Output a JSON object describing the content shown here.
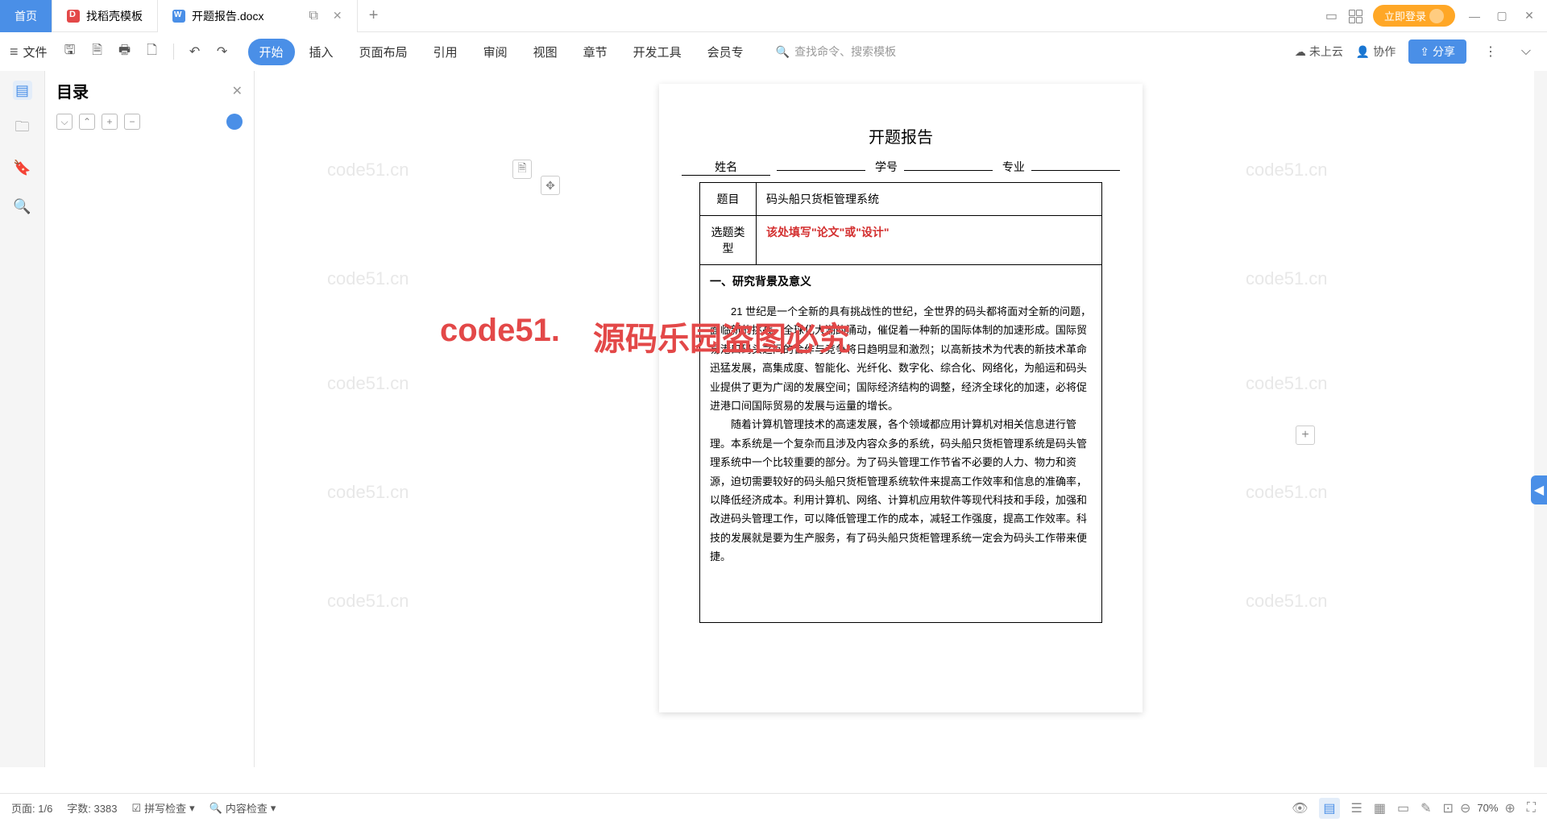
{
  "tabs": {
    "home": "首页",
    "template": "找稻壳模板",
    "doc": "开题报告.docx",
    "newtab": "+"
  },
  "titlebar": {
    "login": "立即登录"
  },
  "toolbar": {
    "file": "文件",
    "search_placeholder": "查找命令、搜索模板",
    "cloud": "未上云",
    "coop": "协作",
    "share": "分享"
  },
  "menu": {
    "start": "开始",
    "insert": "插入",
    "layout": "页面布局",
    "ref": "引用",
    "review": "审阅",
    "view": "视图",
    "chapter": "章节",
    "dev": "开发工具",
    "member": "会员专"
  },
  "sidebar": {
    "title": "目录"
  },
  "doc": {
    "title": "开题报告",
    "f1": "姓名",
    "f2": "学号",
    "f3": "专业",
    "row1_lbl": "题目",
    "row1_val": "码头船只货柜管理系统",
    "row2_lbl": "选题类型",
    "row2_val": "该处填写\"论文\"或\"设计\"",
    "h1": "一、研究背景及意义",
    "p1": "21 世纪是一个全新的具有挑战性的世纪，全世界的码头都将面对全新的问题，面临新的挑战。全球化大潮的涌动，催促着一种新的国际体制的加速形成。国际贸易港口码头之间的合作与竞争将日趋明显和激烈；以高新技术为代表的新技术革命迅猛发展，高集成度、智能化、光纤化、数字化、综合化、网络化，为船运和码头业提供了更为广阔的发展空间；国际经济结构的调整，经济全球化的加速，必将促进港口间国际贸易的发展与运量的增长。",
    "p2": "随着计算机管理技术的高速发展，各个领域都应用计算机对相关信息进行管理。本系统是一个复杂而且涉及内容众多的系统，码头船只货柜管理系统是码头管理系统中一个比较重要的部分。为了码头管理工作节省不必要的人力、物力和资源，迫切需要较好的码头船只货柜管理系统软件来提高工作效率和信息的准确率，以降低经济成本。利用计算机、网络、计算机应用软件等现代科技和手段，加强和改进码头管理工作，可以降低管理工作的成本，减轻工作强度，提高工作效率。科技的发展就是要为生产服务，有了码头船只货柜管理系统一定会为码头工作带来便捷。"
  },
  "watermark": "code51.cn",
  "wm_red1": "code51.",
  "wm_red2": "源码乐园盗图必究",
  "status": {
    "page": "页面: 1/6",
    "words": "字数: 3383",
    "spell": "拼写检查",
    "content": "内容检查",
    "zoom": "70%"
  }
}
